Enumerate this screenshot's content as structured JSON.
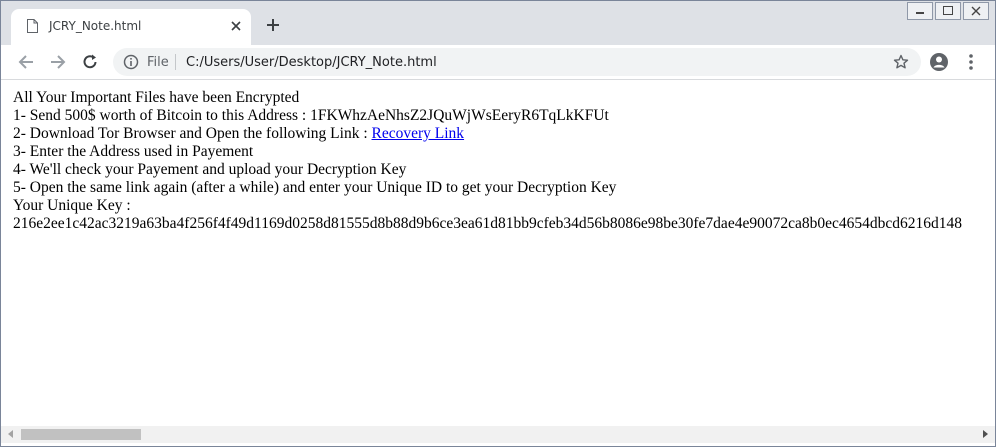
{
  "tab": {
    "title": "JCRY_Note.html"
  },
  "omnibox": {
    "scheme_label": "File",
    "url": "C:/Users/User/Desktop/JCRY_Note.html"
  },
  "note": {
    "line1": "All Your Important Files have been Encrypted",
    "line2": "1- Send 500$ worth of Bitcoin to this Address : 1FKWhzAeNhsZ2JQuWjWsEeryR6TqLkKFUt",
    "line3_prefix": "2- Download Tor Browser and Open the following Link : ",
    "line3_link": "Recovery Link",
    "line4": "3- Enter the Address used in Payement",
    "line5": "4- We'll check your Payement and upload your Decryption Key",
    "line6": "5- Open the same link again (after a while) and enter your Unique ID to get your Decryption Key",
    "line7": "Your Unique Key :",
    "line8": "216e2ee1c42ac3219a63ba4f256f4f49d1169d0258d81555d8b88d9b6ce3ea61d81bb9cfeb34d56b8086e98be30fe7dae4e90072ca8b0ec4654dbcd6216d148"
  },
  "icons": {
    "favicon": "document-icon",
    "tab_close": "close-icon",
    "new_tab": "plus-icon",
    "back": "arrow-left-icon",
    "forward": "arrow-right-icon",
    "reload": "reload-icon",
    "info": "info-icon",
    "bookmark": "star-icon",
    "profile": "account-icon",
    "menu": "more-vert-icon"
  }
}
